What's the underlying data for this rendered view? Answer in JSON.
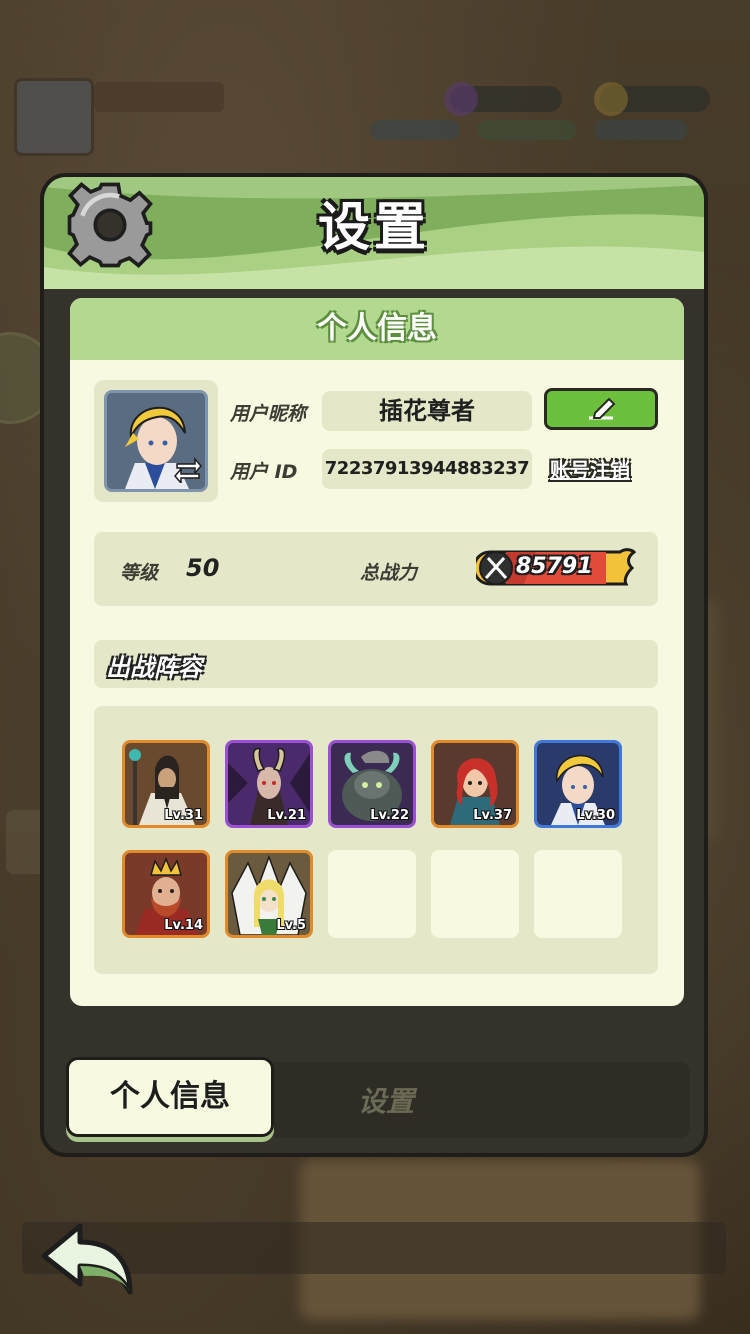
{
  "dialog": {
    "title": "设置",
    "panel_title": "个人信息"
  },
  "profile": {
    "nickname_label": "用户昵称",
    "nickname": "插花尊者",
    "id_label": "用户 ID",
    "user_id": "7223791394488323​7",
    "cancel_account_label": "账号注销",
    "level_label": "等级",
    "level": "50",
    "power_label": "总战力",
    "power": "85791"
  },
  "team": {
    "title": "出战阵容",
    "heroes": [
      {
        "level": "Lv.31",
        "rarity": "orange"
      },
      {
        "level": "Lv.21",
        "rarity": "purple"
      },
      {
        "level": "Lv.22",
        "rarity": "purple"
      },
      {
        "level": "Lv.37",
        "rarity": "orange"
      },
      {
        "level": "Lv.30",
        "rarity": "blue"
      },
      {
        "level": "Lv.14",
        "rarity": "orange"
      },
      {
        "level": "Lv.5",
        "rarity": "orange"
      }
    ],
    "empty_slots": 3
  },
  "tabs": {
    "profile": "个人信息",
    "settings": "设置"
  },
  "colors": {
    "header_green": "#7fae5c",
    "panel_bg": "#f7f9e1",
    "field_bg": "#e4e8c9",
    "edit_green": "#6cc03e",
    "rarity_orange": "#e08a2a",
    "rarity_purple": "#9b4fd4",
    "rarity_blue": "#3f78d8"
  },
  "icons": {
    "header": "gear-icon",
    "edit": "pencil-icon",
    "avatar_swap": "swap-arrows-icon",
    "power": "crossed-swords-icon",
    "back": "back-arrow-icon"
  }
}
